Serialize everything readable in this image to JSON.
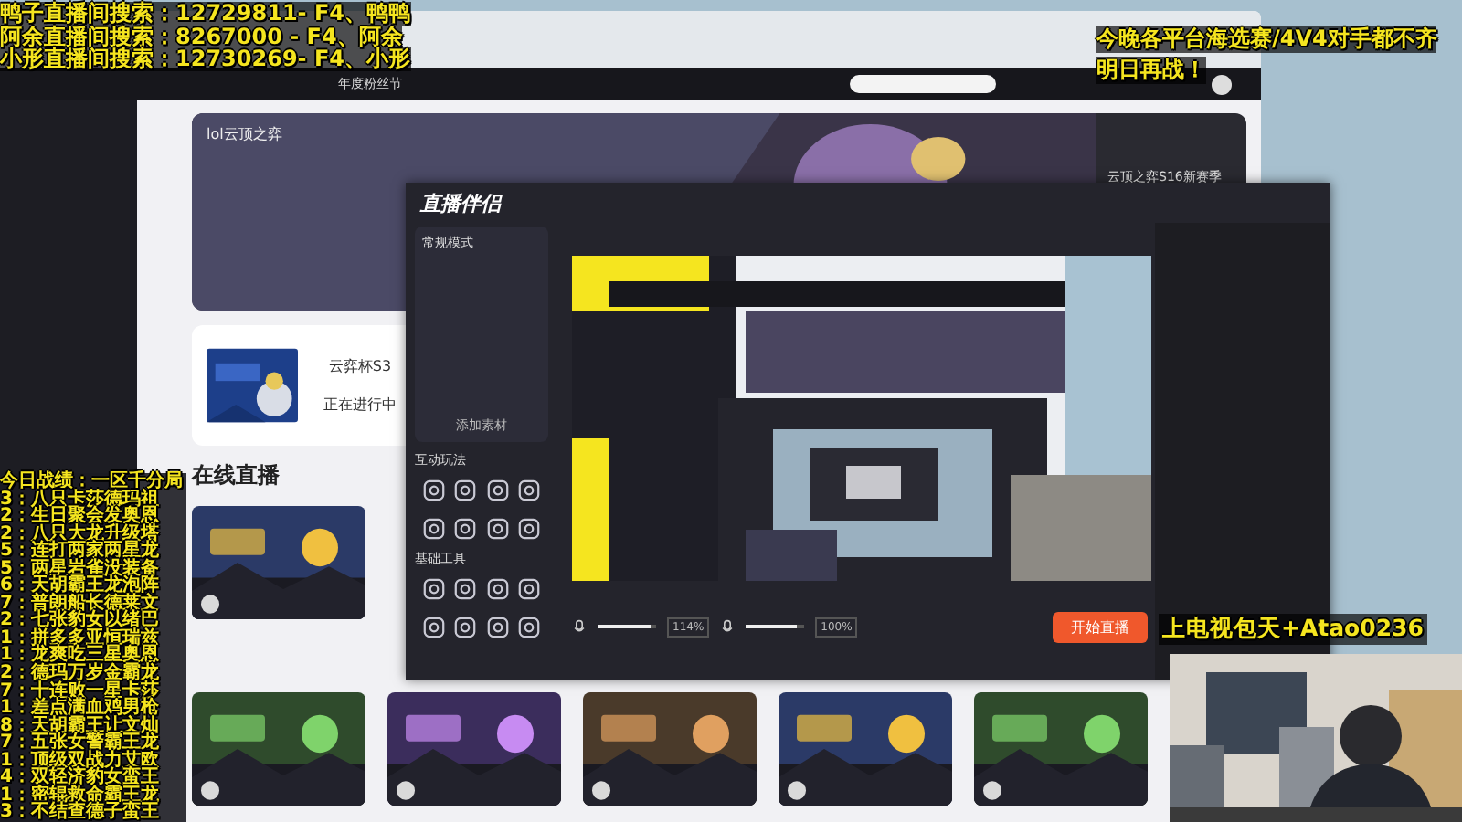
{
  "overlays": {
    "channels": [
      "鸭子直播间搜索：12729811- F4、鸭鸭",
      "阿余直播间搜索：8267000  - F4、阿余",
      "小形直播间搜索：12730269- F4、小形"
    ],
    "notice": [
      "今晚各平台海选赛/4V4对手都不齐",
      "明日再战！"
    ],
    "record": {
      "title": "今日战绩：一区千分局",
      "games": [
        "3：八只卡莎德玛祖",
        "2：生日聚会发奥恩",
        "2：八只大龙升级塔",
        "5：连打两家两星龙",
        "5：两星岩雀没装备",
        "6：天胡霸王龙泡阵",
        "7：普朗船长德莱文",
        "2：七张豹女以绪巴",
        "1：拼多多亚恒瑞兹",
        "1：龙爽吃三星奥恩",
        "2：德玛万岁金霸龙",
        "7：十连败一星卡莎",
        "1：差点满血鸡男枪",
        "8：天胡霸王让文灿",
        "7：五张女警霸王龙",
        "1：顶级双战力艾欧",
        "4：双轻济豹女蛮王",
        "1：密辊救命霸王龙",
        "3：不结查德子蛮王"
      ]
    },
    "caption": "上电视包天+Atao0236"
  },
  "browser": {
    "nav_item": "年度粉丝节",
    "category": "lol云顶之弈",
    "side_title": "云顶之弈S16新赛季",
    "event": {
      "title": "云弈杯S3",
      "status": "正在进行中"
    },
    "section_title": "在线直播"
  },
  "companion": {
    "title": "直播伴侣",
    "mode": "常规模式",
    "add_source": "添加素材",
    "sections": [
      "互动玩法",
      "基础工具"
    ],
    "mixers": [
      {
        "level": 0.9,
        "reading": "114%"
      },
      {
        "level": 0.88,
        "reading": "100%"
      }
    ],
    "start_button": "开始直播"
  }
}
